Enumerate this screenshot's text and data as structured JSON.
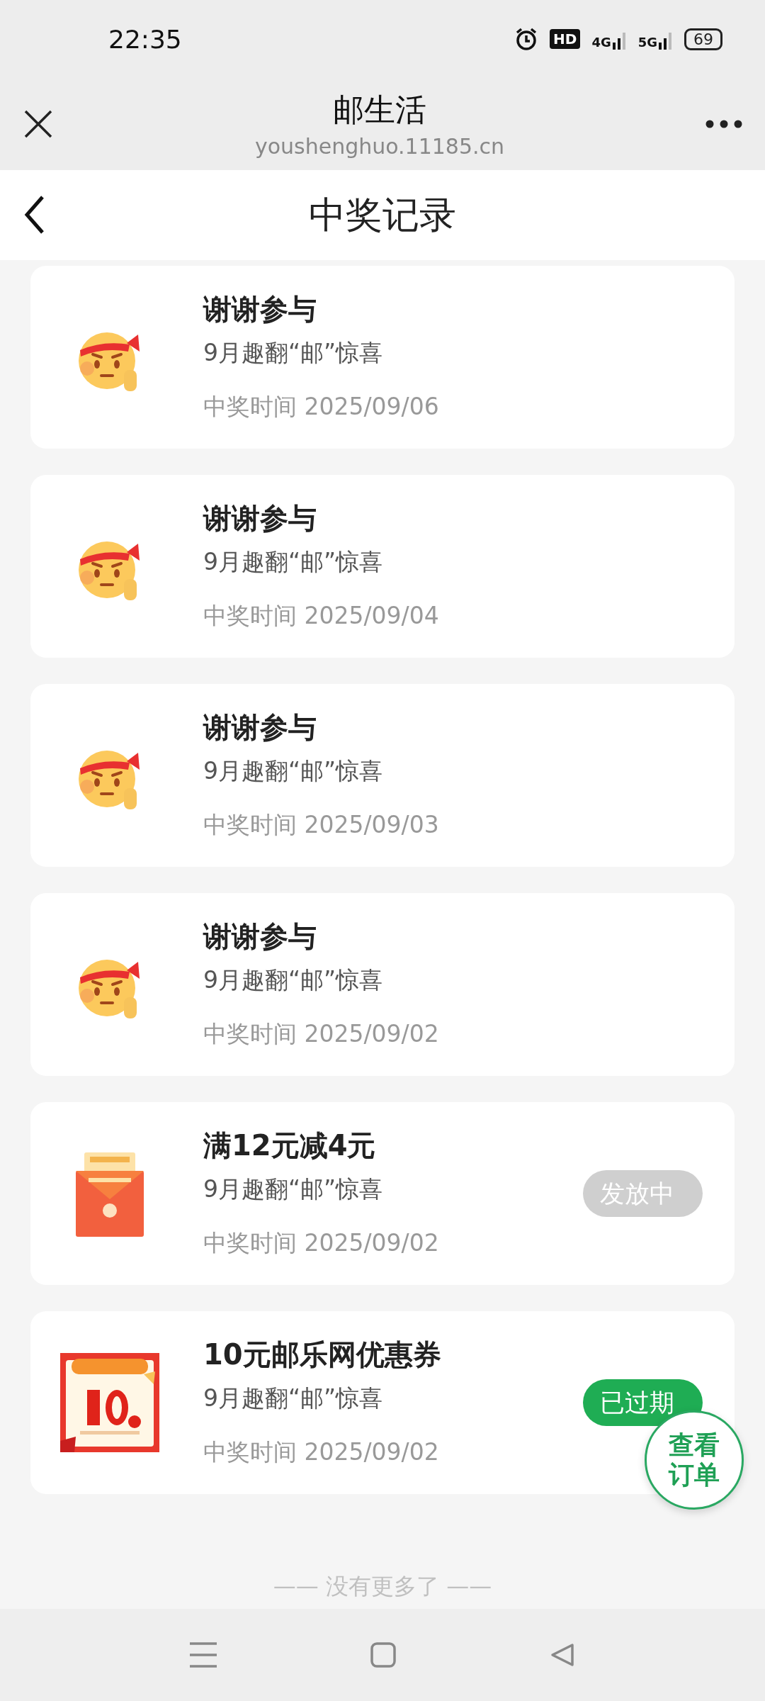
{
  "status_bar": {
    "time": "22:35",
    "hd": "HD",
    "networks": [
      "4G",
      "5G"
    ],
    "battery": "69"
  },
  "browser": {
    "title": "邮生活",
    "url": "youshenghuo.11185.cn"
  },
  "page": {
    "title": "中奖记录"
  },
  "records": [
    {
      "kind": "emoji",
      "title": "谢谢参与",
      "subtitle": "9月趣翻“邮”惊喜",
      "date": "中奖时间 2025/09/06"
    },
    {
      "kind": "emoji",
      "title": "谢谢参与",
      "subtitle": "9月趣翻“邮”惊喜",
      "date": "中奖时间 2025/09/04"
    },
    {
      "kind": "emoji",
      "title": "谢谢参与",
      "subtitle": "9月趣翻“邮”惊喜",
      "date": "中奖时间 2025/09/03"
    },
    {
      "kind": "emoji",
      "title": "谢谢参与",
      "subtitle": "9月趣翻“邮”惊喜",
      "date": "中奖时间 2025/09/02"
    },
    {
      "kind": "envelope",
      "title": "满12元减4元",
      "subtitle": "9月趣翻“邮”惊喜",
      "date": "中奖时间 2025/09/02",
      "status": {
        "kind": "pending",
        "label": "发放中"
      }
    },
    {
      "kind": "coupon",
      "title": "10元邮乐网优惠券",
      "subtitle": "9月趣翻“邮”惊喜",
      "date": "中奖时间 2025/09/02",
      "status": {
        "kind": "expired",
        "label": "已过期"
      }
    }
  ],
  "footer": "—— 没有更多了 ——",
  "floating_button": "查看订单"
}
